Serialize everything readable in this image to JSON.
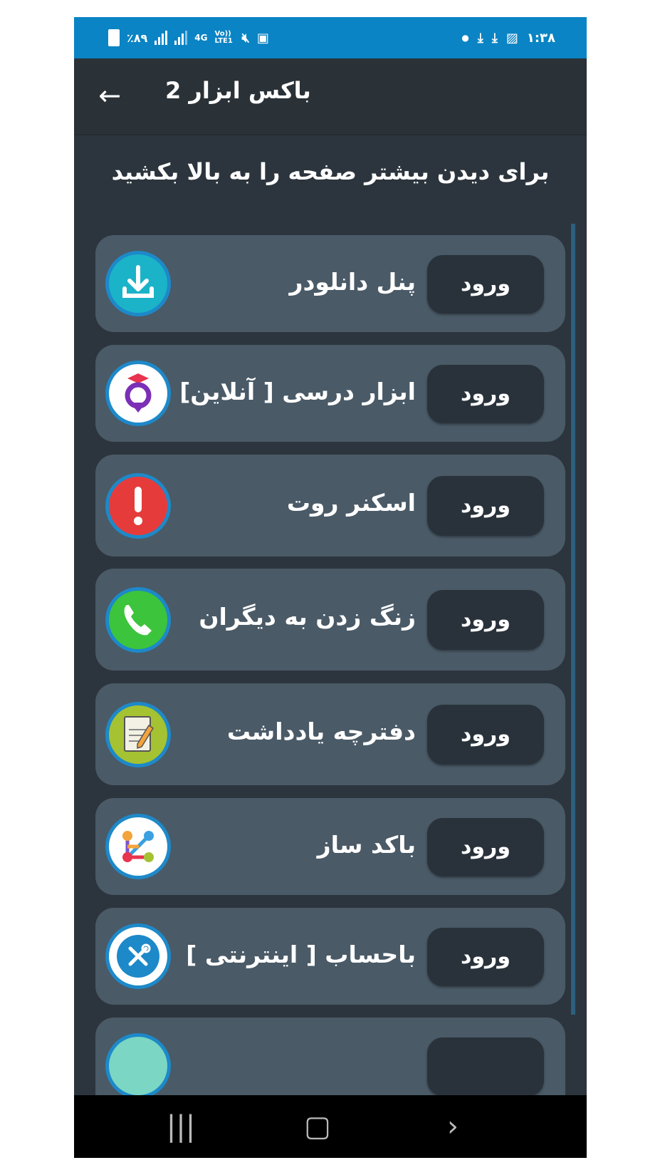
{
  "status_bar": {
    "battery": "٪۸۹",
    "network": "4G",
    "volte": "Vo)) LTE1",
    "time": "۱:۳۸"
  },
  "app_bar": {
    "title": "باکس ابزار 2",
    "back_icon": "arrow-left-icon"
  },
  "hint": "برای دیدن بیشتر صفحه را به بالا بکشید",
  "items": [
    {
      "label": "پنل دانلودر",
      "button": "ورود",
      "icon": "download-icon",
      "color": "#1bb3c8"
    },
    {
      "label": "ابزار درسی [ آنلاین]",
      "button": "ورود",
      "icon": "graduation-pin-icon",
      "color": "#7b2fb6"
    },
    {
      "label": "اسکنر روت",
      "button": "ورود",
      "icon": "exclamation-icon",
      "color": "#e63b3b"
    },
    {
      "label": "زنگ زدن به دیگران",
      "button": "ورود",
      "icon": "phone-icon",
      "color": "#3cc43c"
    },
    {
      "label": "دفترچه یادداشت",
      "button": "ورود",
      "icon": "notepad-icon",
      "color": "#a5c232"
    },
    {
      "label": "باکد ساز",
      "button": "ورود",
      "icon": "graph-nodes-icon",
      "color": "#ffffff"
    },
    {
      "label": "باحساب [ اینترنتی ]",
      "button": "ورود",
      "icon": "tools-icon",
      "color": "#1d89c9"
    }
  ],
  "nav_bar": {
    "recent": "recent-apps-icon",
    "home": "home-icon",
    "back": "back-icon"
  }
}
